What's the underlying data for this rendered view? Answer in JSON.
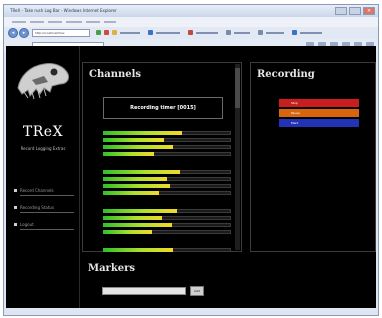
{
  "browser": {
    "title": "TReX - Take rush Log Bar - Windows Internet Explorer",
    "close_glyph": "×",
    "back_glyph": "◂",
    "forward_glyph": "▸",
    "url": "http://localhost/trex",
    "tab_label": "http://localhost/trex/index"
  },
  "sidebar": {
    "brand": "TReX",
    "tagline": "Record Logging Extras",
    "nav": [
      {
        "label": "Record Channels"
      },
      {
        "label": "Recording Status"
      },
      {
        "label": "Logout"
      }
    ]
  },
  "channels": {
    "title": "Channels",
    "status": "Recording timer [0015]",
    "groups": [
      {
        "levels": [
          0.62,
          0.48,
          0.55,
          0.4
        ]
      },
      {
        "levels": [
          0.6,
          0.5,
          0.52,
          0.44
        ]
      },
      {
        "levels": [
          0.58,
          0.46,
          0.54,
          0.38
        ]
      },
      {
        "levels": [
          0.55
        ]
      }
    ]
  },
  "recording": {
    "title": "Recording",
    "buttons": [
      {
        "label": "Stop",
        "color": "#c81e1e"
      },
      {
        "label": "Pause",
        "color": "#d9660f"
      },
      {
        "label": "Mark",
        "color": "#2233b8"
      }
    ]
  },
  "markers": {
    "title": "Markers",
    "input_placeholder": "",
    "add_label": "Add"
  },
  "colors": {
    "page_bg": "#000000",
    "meter_low": "#2ec02a",
    "meter_high": "#f2d92a"
  }
}
